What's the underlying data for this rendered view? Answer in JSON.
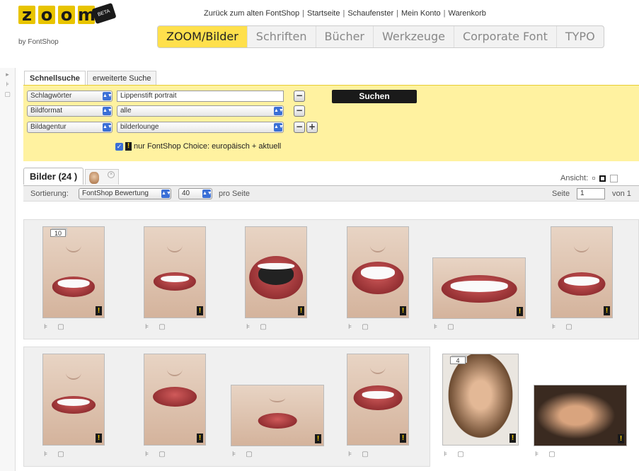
{
  "logo": {
    "letters": [
      "z",
      "o",
      "o",
      "m"
    ],
    "tag": "BETA",
    "byline": "by FontShop"
  },
  "toplinks": [
    "Zurück zum alten FontShop",
    "Startseite",
    "Schaufenster",
    "Mein Konto",
    "Warenkorb"
  ],
  "nav": [
    "ZOOM/Bilder",
    "Schriften",
    "Bücher",
    "Werkzeuge",
    "Corporate Font",
    "TYPO"
  ],
  "search": {
    "tabs": [
      "Schnellsuche",
      "erweiterte Suche"
    ],
    "rows": [
      {
        "field": "Schlagwörter",
        "value": "Lippenstift portrait"
      },
      {
        "field": "Bildformat",
        "value": "alle"
      },
      {
        "field": "Bildagentur",
        "value": "bilderlounge"
      }
    ],
    "button": "Suchen",
    "choice_label": "nur FontShop Choice: europäisch + aktuell",
    "choice_checked": true
  },
  "results": {
    "tab_label": "Bilder (24 )",
    "view_label": "Ansicht:",
    "sort_label": "Sortierung:",
    "sort_value": "FontShop Bewertung",
    "per_page_value": "40",
    "per_page_label": "pro Seite",
    "page_label": "Seite",
    "page_value": "1",
    "page_total": "von 1",
    "counts": [
      "10",
      "4"
    ]
  },
  "icons": {
    "cart": "cart-icon",
    "lightbox": "lightbox-icon",
    "exclam": "fontshop-choice-icon"
  }
}
